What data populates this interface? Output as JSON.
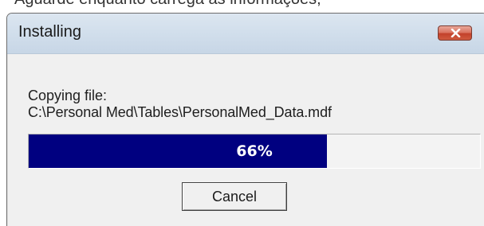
{
  "background_caption": "Aguarde enquanto carrega as informações,",
  "dialog": {
    "title": "Installing",
    "close_icon": "close-x-icon",
    "status_label": "Copying file:",
    "file_path": "C:\\Personal Med\\Tables\\PersonalMed_Data.mdf",
    "progress": {
      "percent": 66,
      "label": "66%"
    },
    "cancel_label": "Cancel"
  },
  "colors": {
    "progress_fill": "#000080",
    "close_button": "#c94a32",
    "titlebar": "#d2dfec"
  }
}
